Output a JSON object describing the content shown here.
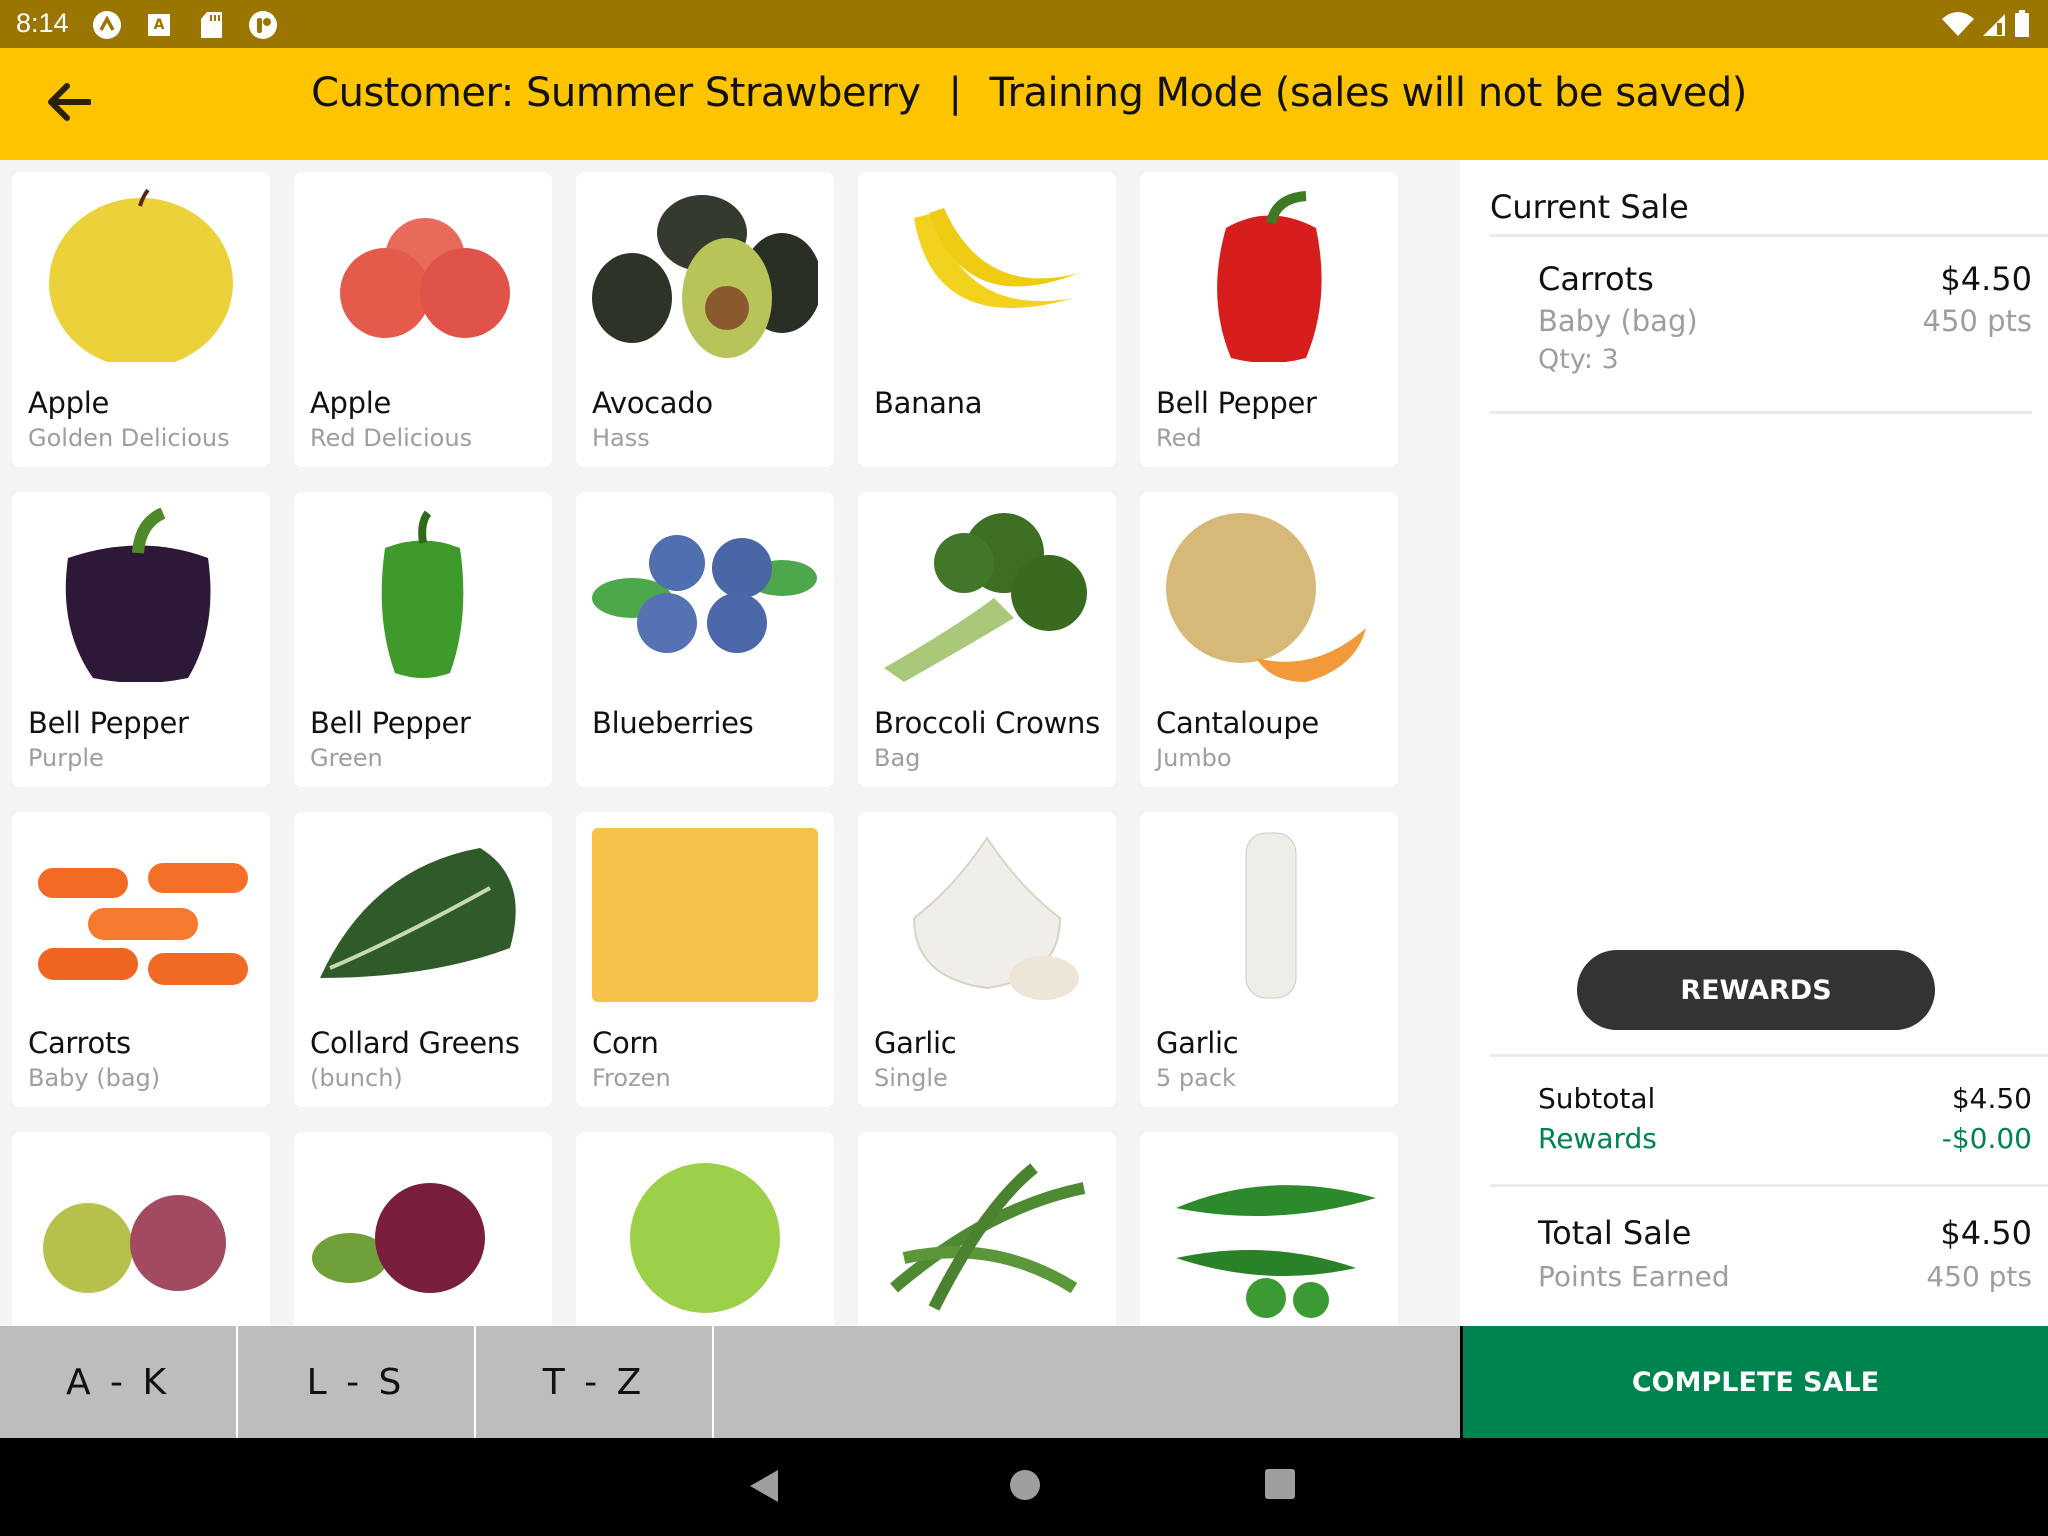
{
  "status_bar": {
    "time": "8:14",
    "left_icons": [
      "app-notification-icon",
      "keyboard-accessibility-icon",
      "sd-card-icon",
      "pocket-app-icon"
    ],
    "right_icons": [
      "wifi-icon",
      "signal-icon",
      "battery-icon"
    ]
  },
  "header": {
    "back_icon": "arrow-left-icon",
    "customer_label": "Customer: Summer Strawberry",
    "separator": "|",
    "mode_label": "Training Mode (sales will not be saved)",
    "background_color": "#FFC400"
  },
  "products": [
    {
      "name": "Apple",
      "variant": "Golden Delicious",
      "image": "golden-apple"
    },
    {
      "name": "Apple",
      "variant": "Red Delicious",
      "image": "red-apples"
    },
    {
      "name": "Avocado",
      "variant": "Hass",
      "image": "avocados"
    },
    {
      "name": "Banana",
      "variant": "",
      "image": "bananas"
    },
    {
      "name": "Bell Pepper",
      "variant": "Red",
      "image": "red-pepper"
    },
    {
      "name": "Bell Pepper",
      "variant": "Purple",
      "image": "purple-pepper"
    },
    {
      "name": "Bell Pepper",
      "variant": "Green",
      "image": "green-pepper"
    },
    {
      "name": "Blueberries",
      "variant": "",
      "image": "blueberries"
    },
    {
      "name": "Broccoli Crowns",
      "variant": "Bag",
      "image": "broccoli"
    },
    {
      "name": "Cantaloupe",
      "variant": "Jumbo",
      "image": "cantaloupe"
    },
    {
      "name": "Carrots",
      "variant": "Baby (bag)",
      "image": "baby-carrots"
    },
    {
      "name": "Collard Greens",
      "variant": "(bunch)",
      "image": "collard-greens"
    },
    {
      "name": "Corn",
      "variant": "Frozen",
      "image": "frozen-corn"
    },
    {
      "name": "Garlic",
      "variant": "Single",
      "image": "garlic-bulb"
    },
    {
      "name": "Garlic",
      "variant": "5 pack",
      "image": "garlic-pack"
    },
    {
      "name": "",
      "variant": "",
      "image": "mixed-grapes"
    },
    {
      "name": "",
      "variant": "",
      "image": "red-grapes"
    },
    {
      "name": "",
      "variant": "",
      "image": "green-grapes"
    },
    {
      "name": "",
      "variant": "",
      "image": "green-beans"
    },
    {
      "name": "",
      "variant": "",
      "image": "jalapenos"
    }
  ],
  "alpha_tabs": [
    {
      "label": "A - K",
      "selected": true
    },
    {
      "label": "L - S",
      "selected": false
    },
    {
      "label": "T - Z",
      "selected": false
    }
  ],
  "sale": {
    "title": "Current Sale",
    "items": [
      {
        "name": "Carrots",
        "variant": "Baby (bag)",
        "qty_label": "Qty: 3",
        "price": "$4.50",
        "points": "450 pts"
      }
    ],
    "rewards_button": "REWARDS",
    "subtotal_label": "Subtotal",
    "subtotal_value": "$4.50",
    "rewards_label": "Rewards",
    "rewards_value": "-$0.00",
    "total_label": "Total Sale",
    "total_value": "$4.50",
    "points_label": "Points Earned",
    "points_value": "450 pts",
    "complete_button": "COMPLETE SALE",
    "accent_color": "#00844F"
  },
  "nav_bar": {
    "icons": [
      "back-triangle-icon",
      "home-circle-icon",
      "recents-square-icon"
    ]
  }
}
